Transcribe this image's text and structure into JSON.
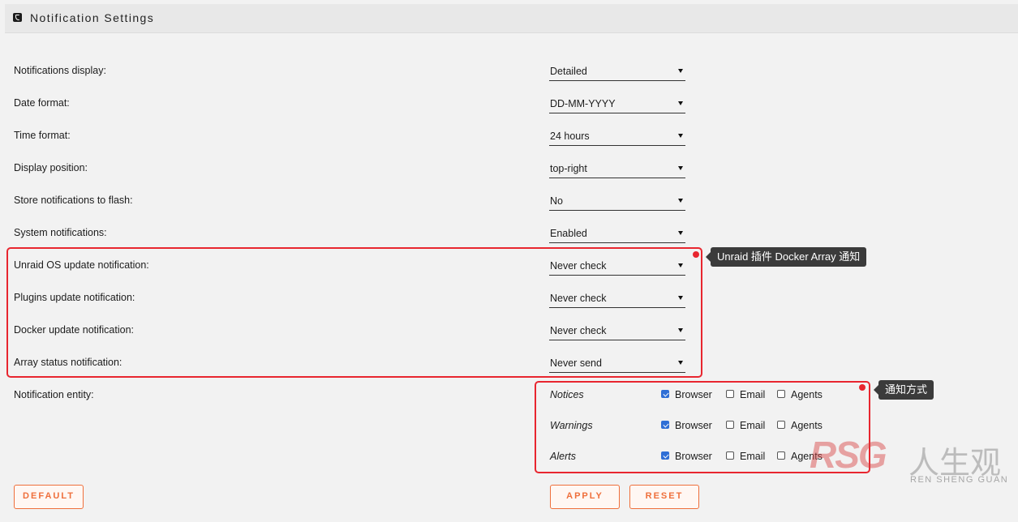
{
  "header": {
    "title": "Notification Settings",
    "icon": "phone-icon"
  },
  "settings": [
    {
      "label": "Notifications display:",
      "value": "Detailed"
    },
    {
      "label": "Date format:",
      "value": "DD-MM-YYYY"
    },
    {
      "label": "Time format:",
      "value": "24 hours"
    },
    {
      "label": "Display position:",
      "value": "top-right"
    },
    {
      "label": "Store notifications to flash:",
      "value": "No"
    },
    {
      "label": "System notifications:",
      "value": "Enabled"
    },
    {
      "label": "Unraid OS update notification:",
      "value": "Never check"
    },
    {
      "label": "Plugins update notification:",
      "value": "Never check"
    },
    {
      "label": "Docker update notification:",
      "value": "Never check"
    },
    {
      "label": "Array status notification:",
      "value": "Never send"
    }
  ],
  "entity": {
    "label": "Notification entity:",
    "rows": [
      {
        "type": "Notices",
        "browser": true,
        "email": false,
        "agents": false
      },
      {
        "type": "Warnings",
        "browser": true,
        "email": false,
        "agents": false
      },
      {
        "type": "Alerts",
        "browser": true,
        "email": false,
        "agents": false
      }
    ],
    "options": {
      "browser": "Browser",
      "email": "Email",
      "agents": "Agents"
    }
  },
  "annotations": {
    "update_tip": "Unraid 插件 Docker Array 通知",
    "entity_tip": "通知方式",
    "highlight_color": "#e8262f"
  },
  "buttons": {
    "default": "DEFAULT",
    "apply": "APPLY",
    "reset": "RESET"
  },
  "watermark": {
    "logo": "RSG",
    "cn": "人生观",
    "en": "REN SHENG GUAN"
  },
  "colors": {
    "accent": "#ef6f3b",
    "checkbox": "#2f6fd6"
  }
}
